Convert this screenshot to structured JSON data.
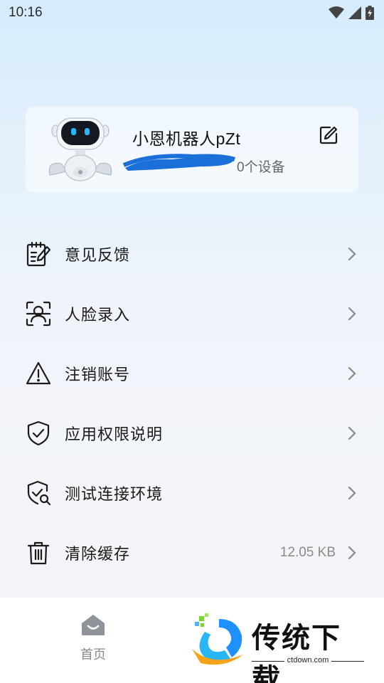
{
  "status_bar": {
    "time": "10:16",
    "icons": [
      "wifi-icon",
      "cellular-signal-icon",
      "battery-charging-icon"
    ]
  },
  "profile": {
    "name": "小恩机器人pZt",
    "device_count": "0个设备",
    "avatar": "robot-avatar",
    "edit_icon": "edit-icon"
  },
  "menu": {
    "items": [
      {
        "label": "意见反馈",
        "icon": "feedback-icon",
        "value": ""
      },
      {
        "label": "人脸录入",
        "icon": "face-scan-icon",
        "value": ""
      },
      {
        "label": "注销账号",
        "icon": "warning-icon",
        "value": ""
      },
      {
        "label": "应用权限说明",
        "icon": "shield-check-icon",
        "value": ""
      },
      {
        "label": "测试连接环境",
        "icon": "shield-search-icon",
        "value": ""
      },
      {
        "label": "清除缓存",
        "icon": "trash-icon",
        "value": "12.05 KB"
      }
    ]
  },
  "bottom_nav": {
    "home_label": "首页",
    "home_icon": "home-icon"
  },
  "watermark": {
    "title": "传统下载",
    "subtitle": "ctdown.com"
  },
  "colors": {
    "accent_blue": "#1e90ff",
    "redaction_blue": "#1a6fd8"
  }
}
